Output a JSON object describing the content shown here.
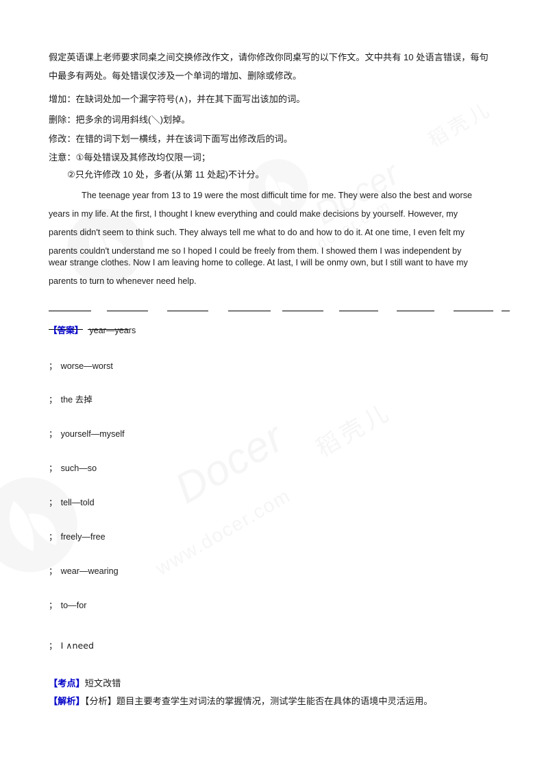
{
  "document": {
    "type": "exam-answer-sheet",
    "language": "zh-CN/en",
    "colors": {
      "label_blue": "#0000c8",
      "text": "#1b1b1b",
      "rule": "#000000",
      "watermark": "#f5f5f5"
    }
  },
  "instructions": {
    "para1": "假定英语课上老师要求同桌之间交换修改作文，请你修改你同桌写的以下作文。文中共有 10 处语言错误，每句中最多有两处。每处错误仅涉及一个单词的增加、删除或修改。",
    "add_rule": "增加：在缺词处加一个漏字符号(∧)，并在其下面写出该加的词。",
    "delete_rule": "删除：把多余的词用斜线(＼)划掉。",
    "modify_rule": "修改：在错的词下划一横线，并在该词下面写出修改后的词。",
    "note_label": "注意：",
    "note1": "①每处错误及其修改均仅限一词；",
    "note2": "②只允许修改 10 处，多者(从第 11 处起)不计分。"
  },
  "passage": {
    "line1": "The teenage year from 13 to 19 were the most difficult time for me. They were also the best and worse",
    "line2": "years in my life. At the first, I thought I knew everything and could make decisions by yourself. However, my",
    "line3": "parents didn't seem to think such. They always tell me what to do and how to do it. At one time, I even felt my",
    "line4": "parents couldn't understand me so I hoped I could be freely from them. I showed them I was independent by",
    "line5": "wear strange clothes. Now I am leaving home to college. At last, I will be onmy own, but I still want to have my",
    "line6": "parents to turn to whenever need help."
  },
  "blanks": {
    "row1_count": 8,
    "row1_trailing_dash": true,
    "row2_count": 2
  },
  "answer": {
    "label": "【答案】",
    "items": [
      {
        "separator": "",
        "text": "year—years"
      },
      {
        "separator": "；",
        "text": "worse—worst"
      },
      {
        "separator": "；",
        "text": "the 去掉"
      },
      {
        "separator": "；",
        "text": "yourself—myself"
      },
      {
        "separator": "；",
        "text": "such—so"
      },
      {
        "separator": "；",
        "text": "tell—told"
      },
      {
        "separator": "；",
        "text": "freely—free"
      },
      {
        "separator": "；",
        "text": "wear—wearing"
      },
      {
        "separator": "；",
        "text": "to—for"
      },
      {
        "separator": "；",
        "text": "I ∧need"
      }
    ]
  },
  "footer": {
    "kaodian_label": "【考点】",
    "kaodian_text": "短文改错",
    "jiexi_label": "【解析】",
    "fenxi_label": "【分析】",
    "jiexi_text": "题目主要考查学生对词法的掌握情况，测试学生能否在具体的语境中灵活运用。"
  },
  "watermark": {
    "brand": "Docer",
    "url": "www.docer.com",
    "cn_brand": "稻壳儿"
  }
}
